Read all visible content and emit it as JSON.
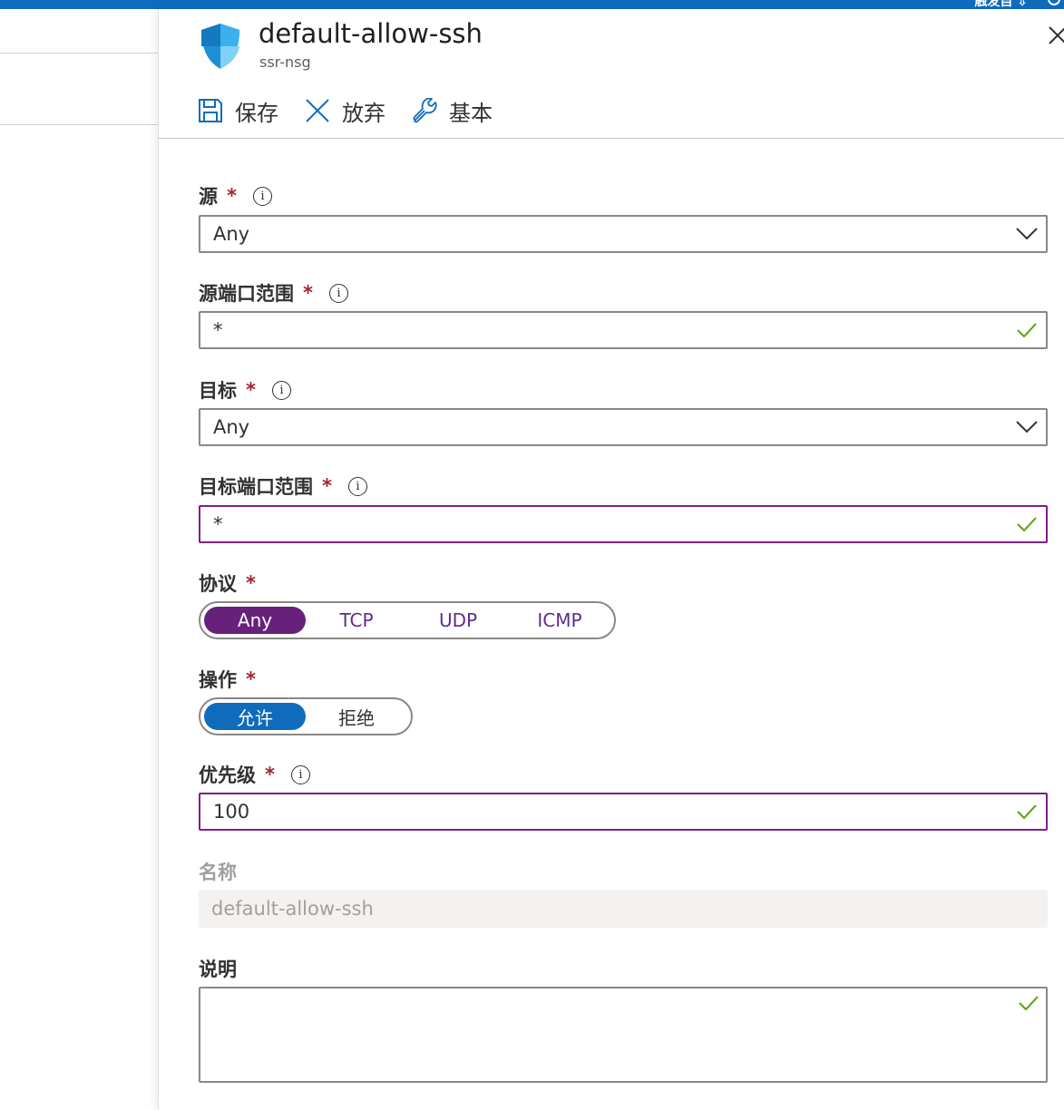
{
  "topbar": {
    "text": "触发自 ⇩"
  },
  "panel": {
    "title": "default-allow-ssh",
    "subtitle": "ssr-nsg",
    "icons": {
      "resource": "shield-icon",
      "close": "close-icon"
    }
  },
  "toolbar": {
    "save_label": "保存",
    "discard_label": "放弃",
    "basic_label": "基本"
  },
  "form": {
    "source": {
      "label": "源",
      "required": "*",
      "value": "Any"
    },
    "source_port_range": {
      "label": "源端口范围",
      "required": "*",
      "value": "*"
    },
    "destination": {
      "label": "目标",
      "required": "*",
      "value": "Any"
    },
    "destination_port_range": {
      "label": "目标端口范围",
      "required": "*",
      "value": "*"
    },
    "protocol": {
      "label": "协议",
      "required": "*",
      "options": [
        "Any",
        "TCP",
        "UDP",
        "ICMP"
      ],
      "selected": "Any"
    },
    "action": {
      "label": "操作",
      "required": "*",
      "options": [
        "允许",
        "拒绝"
      ],
      "selected": "允许"
    },
    "priority": {
      "label": "优先级",
      "required": "*",
      "value": "100"
    },
    "name": {
      "label": "名称",
      "value": "default-allow-ssh"
    },
    "description": {
      "label": "说明",
      "value": ""
    },
    "info_glyph": "i"
  },
  "colors": {
    "accent_blue": "#0f6cbd",
    "accent_purple": "#68217a",
    "focus_border": "#7e1f86",
    "required": "#a4262c",
    "valid_check": "#57a300"
  }
}
